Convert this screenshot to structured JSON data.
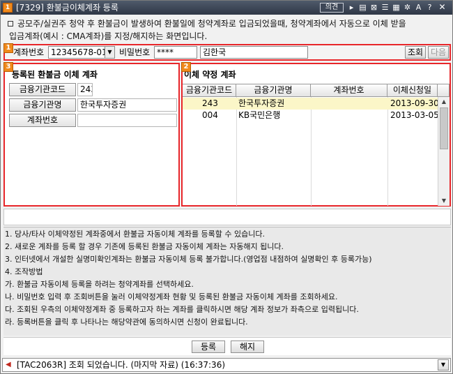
{
  "window": {
    "icon_text": "1",
    "title": "[7329] 환불금이체계좌 등록",
    "opinion_label": "의견"
  },
  "titlebar_icons": [
    "pin-icon",
    "book-icon",
    "print-icon",
    "list-icon",
    "grid-icon",
    "settings-icon",
    "font-icon",
    "help-icon"
  ],
  "description": {
    "line1": "공모주/실권주 청약 후 환불금이 발생하여 환불일에 청약계좌로 입금되었을때, 청약계좌에서 자동으로 이체 받을",
    "line2": "입금계좌(예시 : CMA계좌)를 지정/해지하는 화면입니다."
  },
  "markers": {
    "m1": "1",
    "m2": "2",
    "m3": "3"
  },
  "account_bar": {
    "account_label": "계좌번호",
    "account_value": "12345678-01",
    "password_label": "비밀번호",
    "password_value": "****",
    "name_value": "김한국",
    "query_button": "조회",
    "next_button": "다음"
  },
  "registered": {
    "title": "등록된 환불금 이체 계좌",
    "bank_code_label": "금융기관코드",
    "bank_code_value": "243",
    "bank_name_label": "금융기관명",
    "bank_name_value": "한국투자증권",
    "account_no_label": "계좌번호",
    "account_no_value": ""
  },
  "agreed": {
    "title": "이체 약정 계좌",
    "columns": [
      "금융기관코드",
      "금융기관명",
      "계좌번호",
      "이체신청일"
    ],
    "rows": [
      {
        "code": "243",
        "name": "한국투자증권",
        "account": "",
        "date": "2013-09-30"
      },
      {
        "code": "004",
        "name": "KB국민은행",
        "account": "",
        "date": "2013-03-05"
      }
    ]
  },
  "notes": [
    "1. 당사/타사 이체약정된 계좌중에서 환불금 자동이체 계좌를 등록할 수 있습니다.",
    "2. 새로운 계좌를 등록 할 경우 기존에 등록된 환불금 자동이체 계좌는 자동해지 됩니다.",
    "3. 인터넷에서 개설한 실명미확인계좌는 환불금 자동이체 등록 불가합니다.(영업점 내점하여 실명확인 후 등록가능)",
    "4. 조작방법",
    "가. 환불금 자동이체 등록을 하려는 청약계좌를 선택하세요.",
    "나. 비밀번호 입력 후 조회버튼을 눌러 이체약정계좌 현황 및 등록된 환불금 자동이체 계좌를 조회하세요.",
    "다. 조회된 우측의 이체약정계좌 중 등록하고자 하는 계좌를 클릭하시면 해당 계좌 정보가 좌측으로 입력됩니다.",
    "라. 등록버튼을 클릭 후 나타나는 해당약관에 동의하시면 신청이 완료됩니다."
  ],
  "actions": {
    "register": "등록",
    "cancel": "해지"
  },
  "status": {
    "message": "[TAC2063R] 조회 되었습니다. (마지막 자료) (16:37:36)"
  },
  "colors": {
    "highlight_border": "#e8262a",
    "marker": "#f08a1c",
    "selected_row": "#fbf6c8",
    "titlebar": "#3a4354"
  }
}
